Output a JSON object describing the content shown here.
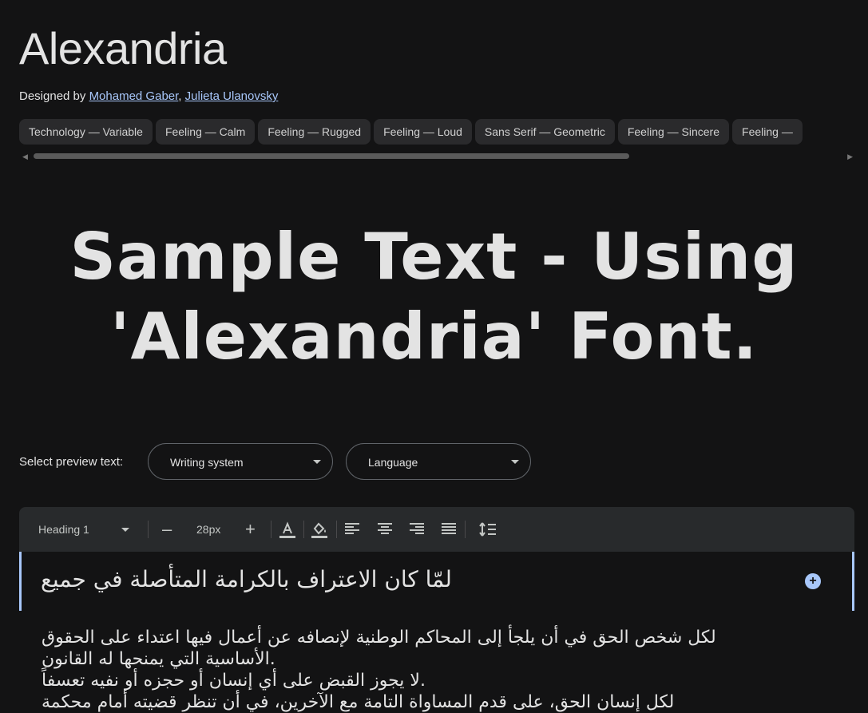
{
  "font": {
    "title": "Alexandria",
    "designed_by_label": "Designed by",
    "designers": [
      "Mohamed Gaber",
      "Julieta Ulanovsky"
    ]
  },
  "tags": [
    "Technology — Variable",
    "Feeling — Calm",
    "Feeling — Rugged",
    "Feeling — Loud",
    "Sans Serif — Geometric",
    "Feeling — Sincere",
    "Feeling — "
  ],
  "sample": {
    "line1": "Sample Text - Using",
    "line2": "'Alexandria' Font."
  },
  "preview": {
    "label": "Select preview text:",
    "writing_system": "Writing system",
    "language": "Language"
  },
  "toolbar": {
    "style": "Heading 1",
    "decrease": "–",
    "size": "28px",
    "increase": "+"
  },
  "editor": {
    "heading": "لمّا كان الاعتراف بالكرامة المتأصلة في جميع",
    "add_symbol": "+",
    "paragraphs": [
      "لكل شخص الحق في أن يلجأ إلى المحاكم الوطنية لإنصافه عن أعمال فيها اعتداء على الحقوق",
      "الأساسية التي يمنحها له القانون.",
      "لا يجوز القبض على أي إنسان أو حجزه أو نفيه تعسفاً.",
      "لكل إنسان الحق، على قدم المساواة التامة مع الآخرين، في أن تنظر قضيته أمام محكمة"
    ]
  },
  "colors": {
    "background": "#131314",
    "link": "#a8c7fa",
    "accent": "#a8c7fa",
    "toolbar": "#282a2c"
  }
}
